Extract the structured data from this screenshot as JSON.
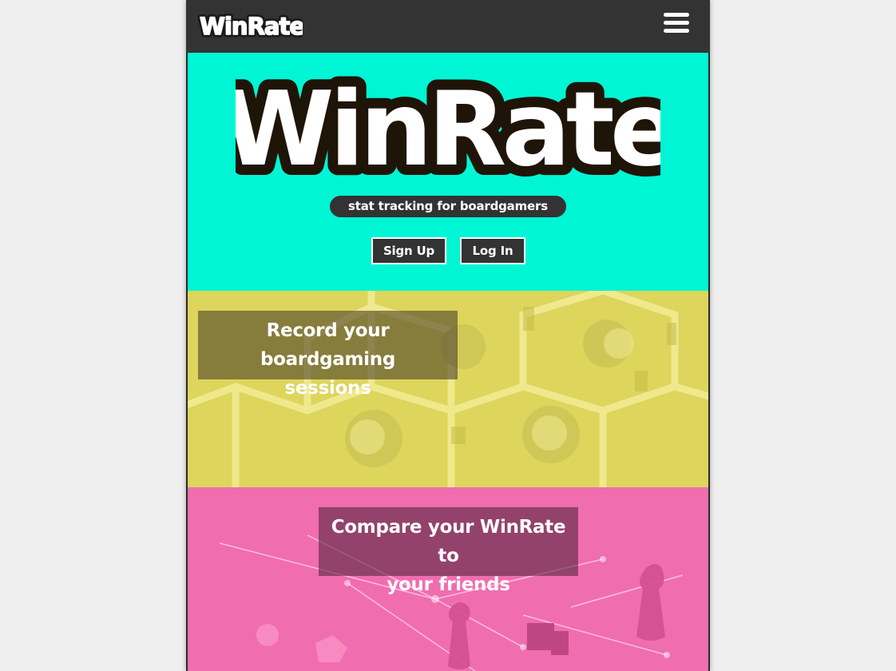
{
  "navbar": {
    "logo_text": "WinRate",
    "menu_icon": "hamburger-menu-icon"
  },
  "hero": {
    "logo_text": "WinRate",
    "tagline": "stat tracking for boardgamers",
    "signup_label": "Sign Up",
    "login_label": "Log In"
  },
  "features": [
    {
      "caption_line1": "Record your boardgaming",
      "caption_line2": "sessions",
      "tint_color": "#ddd55c"
    },
    {
      "caption_line1": "Compare your WinRate to",
      "caption_line2": "your friends",
      "tint_color": "#f06db0"
    }
  ],
  "colors": {
    "navbar": "#333333",
    "hero_background": "#00f5d4",
    "button_background": "#333333",
    "button_text": "#ffffff"
  }
}
